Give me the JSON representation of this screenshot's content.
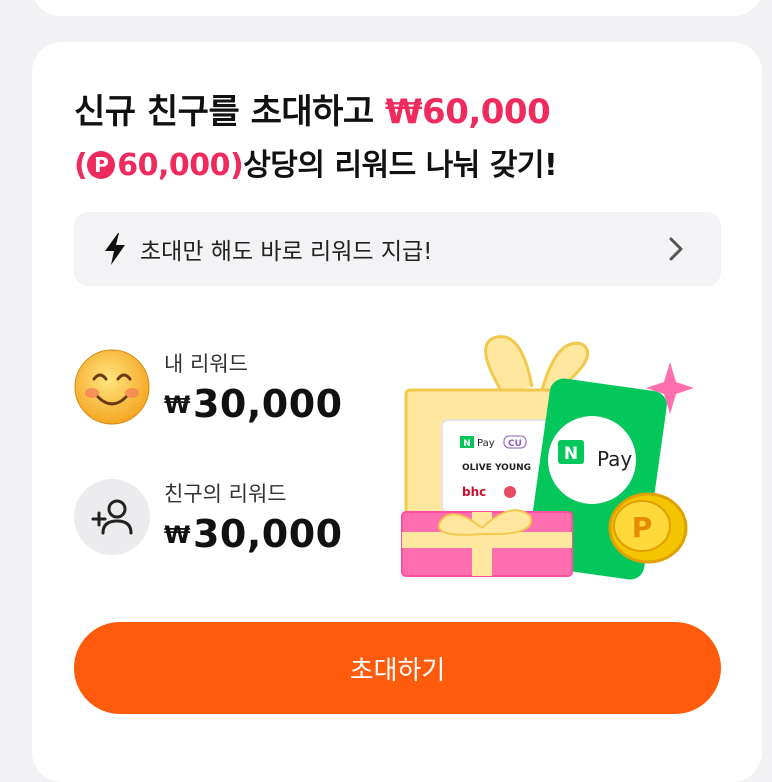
{
  "headline": {
    "line1_prefix": "신규 친구를 초대하고 ",
    "line1_amount": "₩60,000",
    "line2_open": "(",
    "line2_point_symbol": "P",
    "line2_point_amount": "60,000)",
    "line2_suffix": "상당의 리워드 나눠 갖기!"
  },
  "notice": {
    "text": "초대만 해도 바로 리워드 지급!"
  },
  "my_reward": {
    "label": "내 리워드",
    "currency": "₩",
    "amount": "30,000"
  },
  "friend_reward": {
    "label": "친구의 리워드",
    "currency": "₩",
    "amount": "30,000"
  },
  "illustration": {
    "gift_card_labels": {
      "npay": "Pay",
      "cu": "CU",
      "olive": "OLIVE YOUNG",
      "bhc": "bhc"
    },
    "npay_card": {
      "n": "N",
      "pay": "Pay"
    },
    "coin": "P"
  },
  "cta": {
    "label": "초대하기"
  },
  "colors": {
    "accent_red": "#ef2b5e",
    "cta_orange": "#ff5b0c",
    "npay_green": "#03c75a"
  },
  "icons": [
    "lightning-icon",
    "chevron-right-icon",
    "smile-avatar-icon",
    "add-person-icon",
    "gift-reward-illustration"
  ]
}
